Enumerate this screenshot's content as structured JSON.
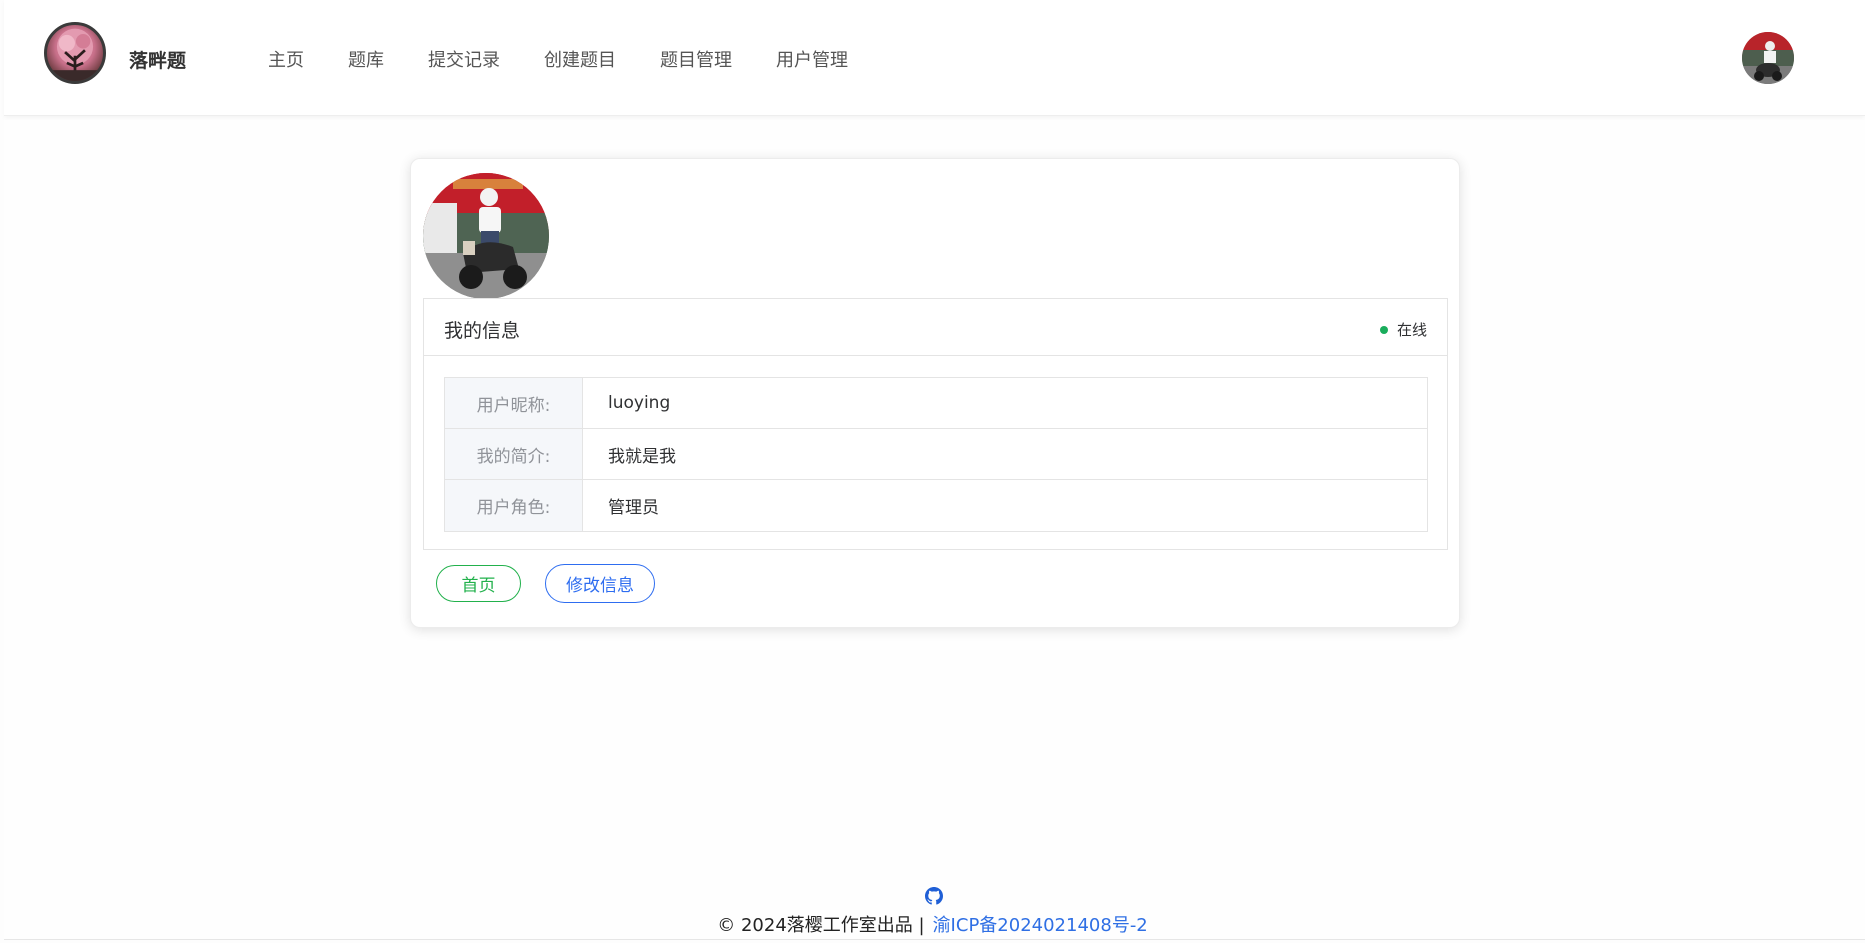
{
  "header": {
    "brand": "落畔题",
    "nav": [
      "主页",
      "题库",
      "提交记录",
      "创建题目",
      "题目管理",
      "用户管理"
    ]
  },
  "profile": {
    "panel_title": "我的信息",
    "status": "在线",
    "rows": [
      {
        "label": "用户昵称:",
        "value": "luoying"
      },
      {
        "label": "我的简介:",
        "value": "我就是我"
      },
      {
        "label": "用户角色:",
        "value": "管理员"
      }
    ],
    "buttons": {
      "home": "首页",
      "edit": "修改信息"
    }
  },
  "footer": {
    "copyright": "© 2024落樱工作室出品 |",
    "icp": "渝ICP备2024021408号-2",
    "icon": "github-icon"
  },
  "colors": {
    "accent_green": "#22b14c",
    "accent_blue": "#2e6df0",
    "status_online": "#1aad5c"
  }
}
